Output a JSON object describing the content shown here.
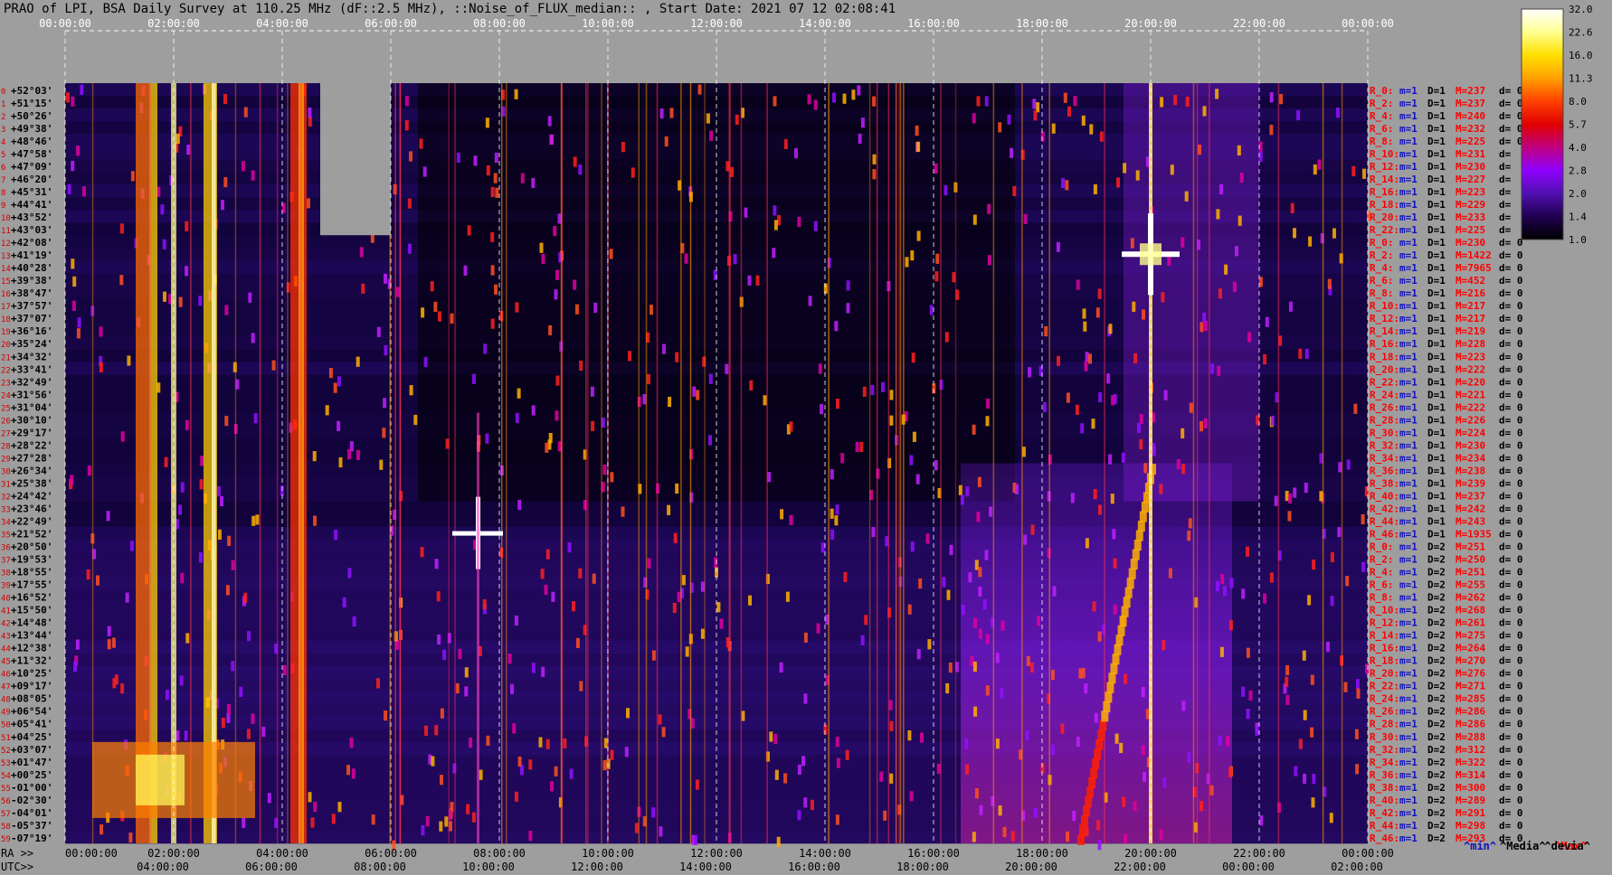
{
  "title": "PRAO of LPI, BSA Daily Survey at 110.25 MHz (dF::2.5 MHz), ::Noise_of_FLUX_median:: , Start Date: 2021 07 12 02:08:41",
  "legend": [
    {
      "label": "^min^",
      "color": "#1010c0"
    },
    {
      "label": "^Media^",
      "color": "#000000"
    },
    {
      "label": "^Max^",
      "color": "#ff0000"
    },
    {
      "label": "^devia^",
      "color": "#000000"
    }
  ],
  "chart_data": {
    "type": "heatmap",
    "title": "PRAO of LPI, BSA Daily Survey at 110.25 MHz (dF::2.5 MHz), ::Noise_of_FLUX_median:: , Start Date: 2021 07 12 02:08:41",
    "top_axis": [
      "00:00:00",
      "02:00:00",
      "04:00:00",
      "06:00:00",
      "08:00:00",
      "10:00:00",
      "12:00:00",
      "14:00:00",
      "16:00:00",
      "18:00:00",
      "20:00:00",
      "22:00:00",
      "00:00:00"
    ],
    "ra_prefix": "RA >>",
    "ra_axis": [
      "00:00:00",
      "02:00:00",
      "04:00:00",
      "06:00:00",
      "08:00:00",
      "10:00:00",
      "12:00:00",
      "14:00:00",
      "16:00:00",
      "18:00:00",
      "20:00:00",
      "22:00:00",
      "00:00:00"
    ],
    "utc_prefix": "UTC>>",
    "utc_axis": [
      "04:00:00",
      "06:00:00",
      "08:00:00",
      "10:00:00",
      "12:00:00",
      "14:00:00",
      "16:00:00",
      "18:00:00",
      "20:00:00",
      "22:00:00",
      "00:00:00",
      "02:00:00"
    ],
    "declinations": [
      "+52°03'",
      "+51°15'",
      "+50°26'",
      "+49°38'",
      "+48°46'",
      "+47°58'",
      "+47°09'",
      "+46°20'",
      "+45°31'",
      "+44°41'",
      "+43°52'",
      "+43°03'",
      "+42°08'",
      "+41°19'",
      "+40°28'",
      "+39°38'",
      "+38°47'",
      "+37°57'",
      "+37°07'",
      "+36°16'",
      "+35°24'",
      "+34°32'",
      "+33°41'",
      "+32°49'",
      "+31°56'",
      "+31°04'",
      "+30°10'",
      "+29°17'",
      "+28°22'",
      "+27°28'",
      "+26°34'",
      "+25°38'",
      "+24°42'",
      "+23°46'",
      "+22°49'",
      "+21°52'",
      "+20°50'",
      "+19°53'",
      "+18°55'",
      "+17°55'",
      "+16°52'",
      "+15°50'",
      "+14°48'",
      "+13°44'",
      "+12°38'",
      "+11°32'",
      "+10°25'",
      "+09°17'",
      "+08°05'",
      "+06°54'",
      "+05°41'",
      "+04°25'",
      "+03°07'",
      "+01°47'",
      "+00°25'",
      "-01°00'",
      "-02°30'",
      "-04°01'",
      "-05°37'",
      "-07°19'"
    ],
    "beam_index": [
      "0",
      "1",
      "2",
      "3",
      "4",
      "5",
      "6",
      "7",
      "8",
      "9",
      "10",
      "11",
      "12",
      "13",
      "14",
      "15",
      "16",
      "17",
      "18",
      "19",
      "20",
      "21",
      "22",
      "23",
      "24",
      "25",
      "26",
      "27",
      "28",
      "29",
      "30",
      "31",
      "32",
      "33",
      "34",
      "35",
      "36",
      "37",
      "38",
      "39",
      "40",
      "41",
      "42",
      "43",
      "44",
      "45",
      "46",
      "47",
      "48",
      "49",
      "50",
      "51",
      "52",
      "53",
      "54",
      "55",
      "56",
      "57",
      "58",
      "59"
    ],
    "colorbar": {
      "ticks": [
        "32.0",
        "22.6",
        "16.0",
        "11.3",
        "8.0",
        "5.7",
        "4.0",
        "2.8",
        "2.0",
        "1.4",
        "1.0"
      ],
      "colors": [
        "#ffffff",
        "#ffff90",
        "#ffe000",
        "#ffa000",
        "#ff4000",
        "#e00000",
        "#c00080",
        "#9000ff",
        "#5010b0",
        "#200050",
        "#000000"
      ]
    },
    "row_stats": [
      {
        "r": "R_0:",
        "m": "m=1",
        "d": "D=1",
        "M": "M=237",
        "dv": "d= 0"
      },
      {
        "r": "R_2:",
        "m": "m=1",
        "d": "D=1",
        "M": "M=237",
        "dv": "d= 0"
      },
      {
        "r": "R_4:",
        "m": "m=1",
        "d": "D=1",
        "M": "M=240",
        "dv": "d= 0"
      },
      {
        "r": "R_6:",
        "m": "m=1",
        "d": "D=1",
        "M": "M=232",
        "dv": "d= 0"
      },
      {
        "r": "R_8:",
        "m": "m=1",
        "d": "D=1",
        "M": "M=225",
        "dv": "d= 0"
      },
      {
        "r": "R_10:",
        "m": "m=1",
        "d": "D=1",
        "M": "M=231",
        "dv": "d="
      },
      {
        "r": "R_12:",
        "m": "m=1",
        "d": "D=1",
        "M": "M=230",
        "dv": "d="
      },
      {
        "r": "R_14:",
        "m": "m=1",
        "d": "D=1",
        "M": "M=227",
        "dv": "d="
      },
      {
        "r": "R_16:",
        "m": "m=1",
        "d": "D=1",
        "M": "M=223",
        "dv": "d="
      },
      {
        "r": "R_18:",
        "m": "m=1",
        "d": "D=1",
        "M": "M=229",
        "dv": "d="
      },
      {
        "r": "R_20:",
        "m": "m=1",
        "d": "D=1",
        "M": "M=233",
        "dv": "d="
      },
      {
        "r": "R_22:",
        "m": "m=1",
        "d": "D=1",
        "M": "M=225",
        "dv": "d="
      },
      {
        "r": "R_0:",
        "m": "m=1",
        "d": "D=1",
        "M": "M=230",
        "dv": "d= 0"
      },
      {
        "r": "R_2:",
        "m": "m=1",
        "d": "D=1",
        "M": "M=1422",
        "dv": "d= 0"
      },
      {
        "r": "R_4:",
        "m": "m=1",
        "d": "D=1",
        "M": "M=7965",
        "dv": "d= 0"
      },
      {
        "r": "R_6:",
        "m": "m=1",
        "d": "D=1",
        "M": "M=452",
        "dv": "d= 0"
      },
      {
        "r": "R_8:",
        "m": "m=1",
        "d": "D=1",
        "M": "M=216",
        "dv": "d= 0"
      },
      {
        "r": "R_10:",
        "m": "m=1",
        "d": "D=1",
        "M": "M=217",
        "dv": "d= 0"
      },
      {
        "r": "R_12:",
        "m": "m=1",
        "d": "D=1",
        "M": "M=217",
        "dv": "d= 0"
      },
      {
        "r": "R_14:",
        "m": "m=1",
        "d": "D=1",
        "M": "M=219",
        "dv": "d= 0"
      },
      {
        "r": "R_16:",
        "m": "m=1",
        "d": "D=1",
        "M": "M=228",
        "dv": "d= 0"
      },
      {
        "r": "R_18:",
        "m": "m=1",
        "d": "D=1",
        "M": "M=223",
        "dv": "d= 0"
      },
      {
        "r": "R_20:",
        "m": "m=1",
        "d": "D=1",
        "M": "M=222",
        "dv": "d= 0"
      },
      {
        "r": "R_22:",
        "m": "m=1",
        "d": "D=1",
        "M": "M=220",
        "dv": "d= 0"
      },
      {
        "r": "R_24:",
        "m": "m=1",
        "d": "D=1",
        "M": "M=221",
        "dv": "d= 0"
      },
      {
        "r": "R_26:",
        "m": "m=1",
        "d": "D=1",
        "M": "M=222",
        "dv": "d= 0"
      },
      {
        "r": "R_28:",
        "m": "m=1",
        "d": "D=1",
        "M": "M=226",
        "dv": "d= 0"
      },
      {
        "r": "R_30:",
        "m": "m=1",
        "d": "D=1",
        "M": "M=224",
        "dv": "d= 0"
      },
      {
        "r": "R_32:",
        "m": "m=1",
        "d": "D=1",
        "M": "M=230",
        "dv": "d= 0"
      },
      {
        "r": "R_34:",
        "m": "m=1",
        "d": "D=1",
        "M": "M=234",
        "dv": "d= 0"
      },
      {
        "r": "R_36:",
        "m": "m=1",
        "d": "D=1",
        "M": "M=238",
        "dv": "d= 0"
      },
      {
        "r": "R_38:",
        "m": "m=1",
        "d": "D=1",
        "M": "M=239",
        "dv": "d= 0"
      },
      {
        "r": "R_40:",
        "m": "m=1",
        "d": "D=1",
        "M": "M=237",
        "dv": "d= 0"
      },
      {
        "r": "R_42:",
        "m": "m=1",
        "d": "D=1",
        "M": "M=242",
        "dv": "d= 0"
      },
      {
        "r": "R_44:",
        "m": "m=1",
        "d": "D=1",
        "M": "M=243",
        "dv": "d= 0"
      },
      {
        "r": "R_46:",
        "m": "m=1",
        "d": "D=1",
        "M": "M=1935",
        "dv": "d= 0"
      },
      {
        "r": "R_0:",
        "m": "m=1",
        "d": "D=2",
        "M": "M=251",
        "dv": "d= 0"
      },
      {
        "r": "R_2:",
        "m": "m=1",
        "d": "D=2",
        "M": "M=250",
        "dv": "d= 0"
      },
      {
        "r": "R_4:",
        "m": "m=1",
        "d": "D=2",
        "M": "M=251",
        "dv": "d= 0"
      },
      {
        "r": "R_6:",
        "m": "m=1",
        "d": "D=2",
        "M": "M=255",
        "dv": "d= 0"
      },
      {
        "r": "R_8:",
        "m": "m=1",
        "d": "D=2",
        "M": "M=262",
        "dv": "d= 0"
      },
      {
        "r": "R_10:",
        "m": "m=1",
        "d": "D=2",
        "M": "M=268",
        "dv": "d= 0"
      },
      {
        "r": "R_12:",
        "m": "m=1",
        "d": "D=2",
        "M": "M=261",
        "dv": "d= 0"
      },
      {
        "r": "R_14:",
        "m": "m=1",
        "d": "D=2",
        "M": "M=275",
        "dv": "d= 0"
      },
      {
        "r": "R_16:",
        "m": "m=1",
        "d": "D=2",
        "M": "M=264",
        "dv": "d= 0"
      },
      {
        "r": "R_18:",
        "m": "m=1",
        "d": "D=2",
        "M": "M=270",
        "dv": "d= 0"
      },
      {
        "r": "R_20:",
        "m": "m=1",
        "d": "D=2",
        "M": "M=276",
        "dv": "d= 0"
      },
      {
        "r": "R_22:",
        "m": "m=1",
        "d": "D=2",
        "M": "M=271",
        "dv": "d= 0"
      },
      {
        "r": "R_24:",
        "m": "m=1",
        "d": "D=2",
        "M": "M=285",
        "dv": "d= 0"
      },
      {
        "r": "R_26:",
        "m": "m=1",
        "d": "D=2",
        "M": "M=286",
        "dv": "d= 0"
      },
      {
        "r": "R_28:",
        "m": "m=1",
        "d": "D=2",
        "M": "M=286",
        "dv": "d= 0"
      },
      {
        "r": "R_30:",
        "m": "m=1",
        "d": "D=2",
        "M": "M=288",
        "dv": "d= 0"
      },
      {
        "r": "R_32:",
        "m": "m=1",
        "d": "D=2",
        "M": "M=312",
        "dv": "d= 0"
      },
      {
        "r": "R_34:",
        "m": "m=1",
        "d": "D=2",
        "M": "M=322",
        "dv": "d= 0"
      },
      {
        "r": "R_36:",
        "m": "m=1",
        "d": "D=2",
        "M": "M=314",
        "dv": "d= 0"
      },
      {
        "r": "R_38:",
        "m": "m=1",
        "d": "D=2",
        "M": "M=300",
        "dv": "d= 0"
      },
      {
        "r": "R_40:",
        "m": "m=1",
        "d": "D=2",
        "M": "M=289",
        "dv": "d= 0"
      },
      {
        "r": "R_42:",
        "m": "m=1",
        "d": "D=2",
        "M": "M=291",
        "dv": "d= 0"
      },
      {
        "r": "R_44:",
        "m": "m=1",
        "d": "D=2",
        "M": "M=298",
        "dv": "d= 0"
      },
      {
        "r": "R_46:",
        "m": "m=1",
        "d": "D=2",
        "M": "M=293",
        "dv": "d= 0"
      }
    ]
  }
}
